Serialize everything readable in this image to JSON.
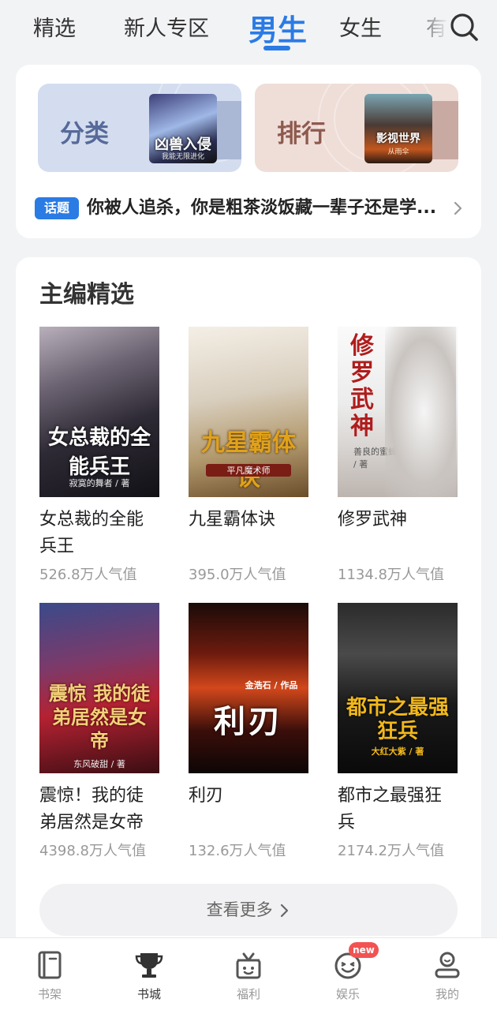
{
  "top_tabs": [
    "精选",
    "新人专区",
    "男生",
    "女生",
    "有"
  ],
  "active_tab": "男生",
  "icons": {
    "search": "search-icon",
    "topic_arrow": "chevron-right-icon"
  },
  "colors": {
    "accent": "#2a7be4",
    "badge_new": "#f25252"
  },
  "entries": {
    "category": {
      "label": "分类",
      "cover_title": "凶兽入侵",
      "cover_sub": "我能无限进化"
    },
    "ranking": {
      "label": "排行",
      "cover_title": "影视世界",
      "cover_sub": "从雨伞"
    }
  },
  "topic": {
    "badge": "话题",
    "text": "你被人追杀，你是粗茶淡饭藏一辈子还是学..."
  },
  "editor_picks": {
    "title": "主编精选",
    "books": [
      {
        "name": "女总裁的全能兵王",
        "popularity": "526.8万人气值",
        "cover_title": "女总裁的全能兵王",
        "cover_author": "寂寞的舞者 / 著"
      },
      {
        "name": "九星霸体诀",
        "popularity": "395.0万人气值",
        "cover_title": "九星霸体诀",
        "cover_author": "平凡魔术师"
      },
      {
        "name": "修罗武神",
        "popularity": "1134.8万人气值",
        "cover_title": "修罗武神",
        "cover_author": "善良的蜜蜂 / 著"
      },
      {
        "name": "震惊！我的徒弟居然是女帝",
        "popularity": "4398.8万人气值",
        "cover_title": "震惊 我的徒弟居然是女帝",
        "cover_author": "东风破甜 / 著"
      },
      {
        "name": "利刃",
        "popularity": "132.6万人气值",
        "cover_title": "利刃",
        "cover_author": "金浩石 / 作品"
      },
      {
        "name": "都市之最强狂兵",
        "popularity": "2174.2万人气值",
        "cover_title": "都市之最强狂兵",
        "cover_author": "大红大紫 / 著"
      }
    ],
    "more_label": "查看更多"
  },
  "bottom_nav": [
    {
      "label": "书架",
      "icon": "bookshelf-icon"
    },
    {
      "label": "书城",
      "icon": "trophy-icon",
      "active": true
    },
    {
      "label": "福利",
      "icon": "gift-icon"
    },
    {
      "label": "娱乐",
      "icon": "smile-icon",
      "badge": "new"
    },
    {
      "label": "我的",
      "icon": "profile-icon"
    }
  ]
}
